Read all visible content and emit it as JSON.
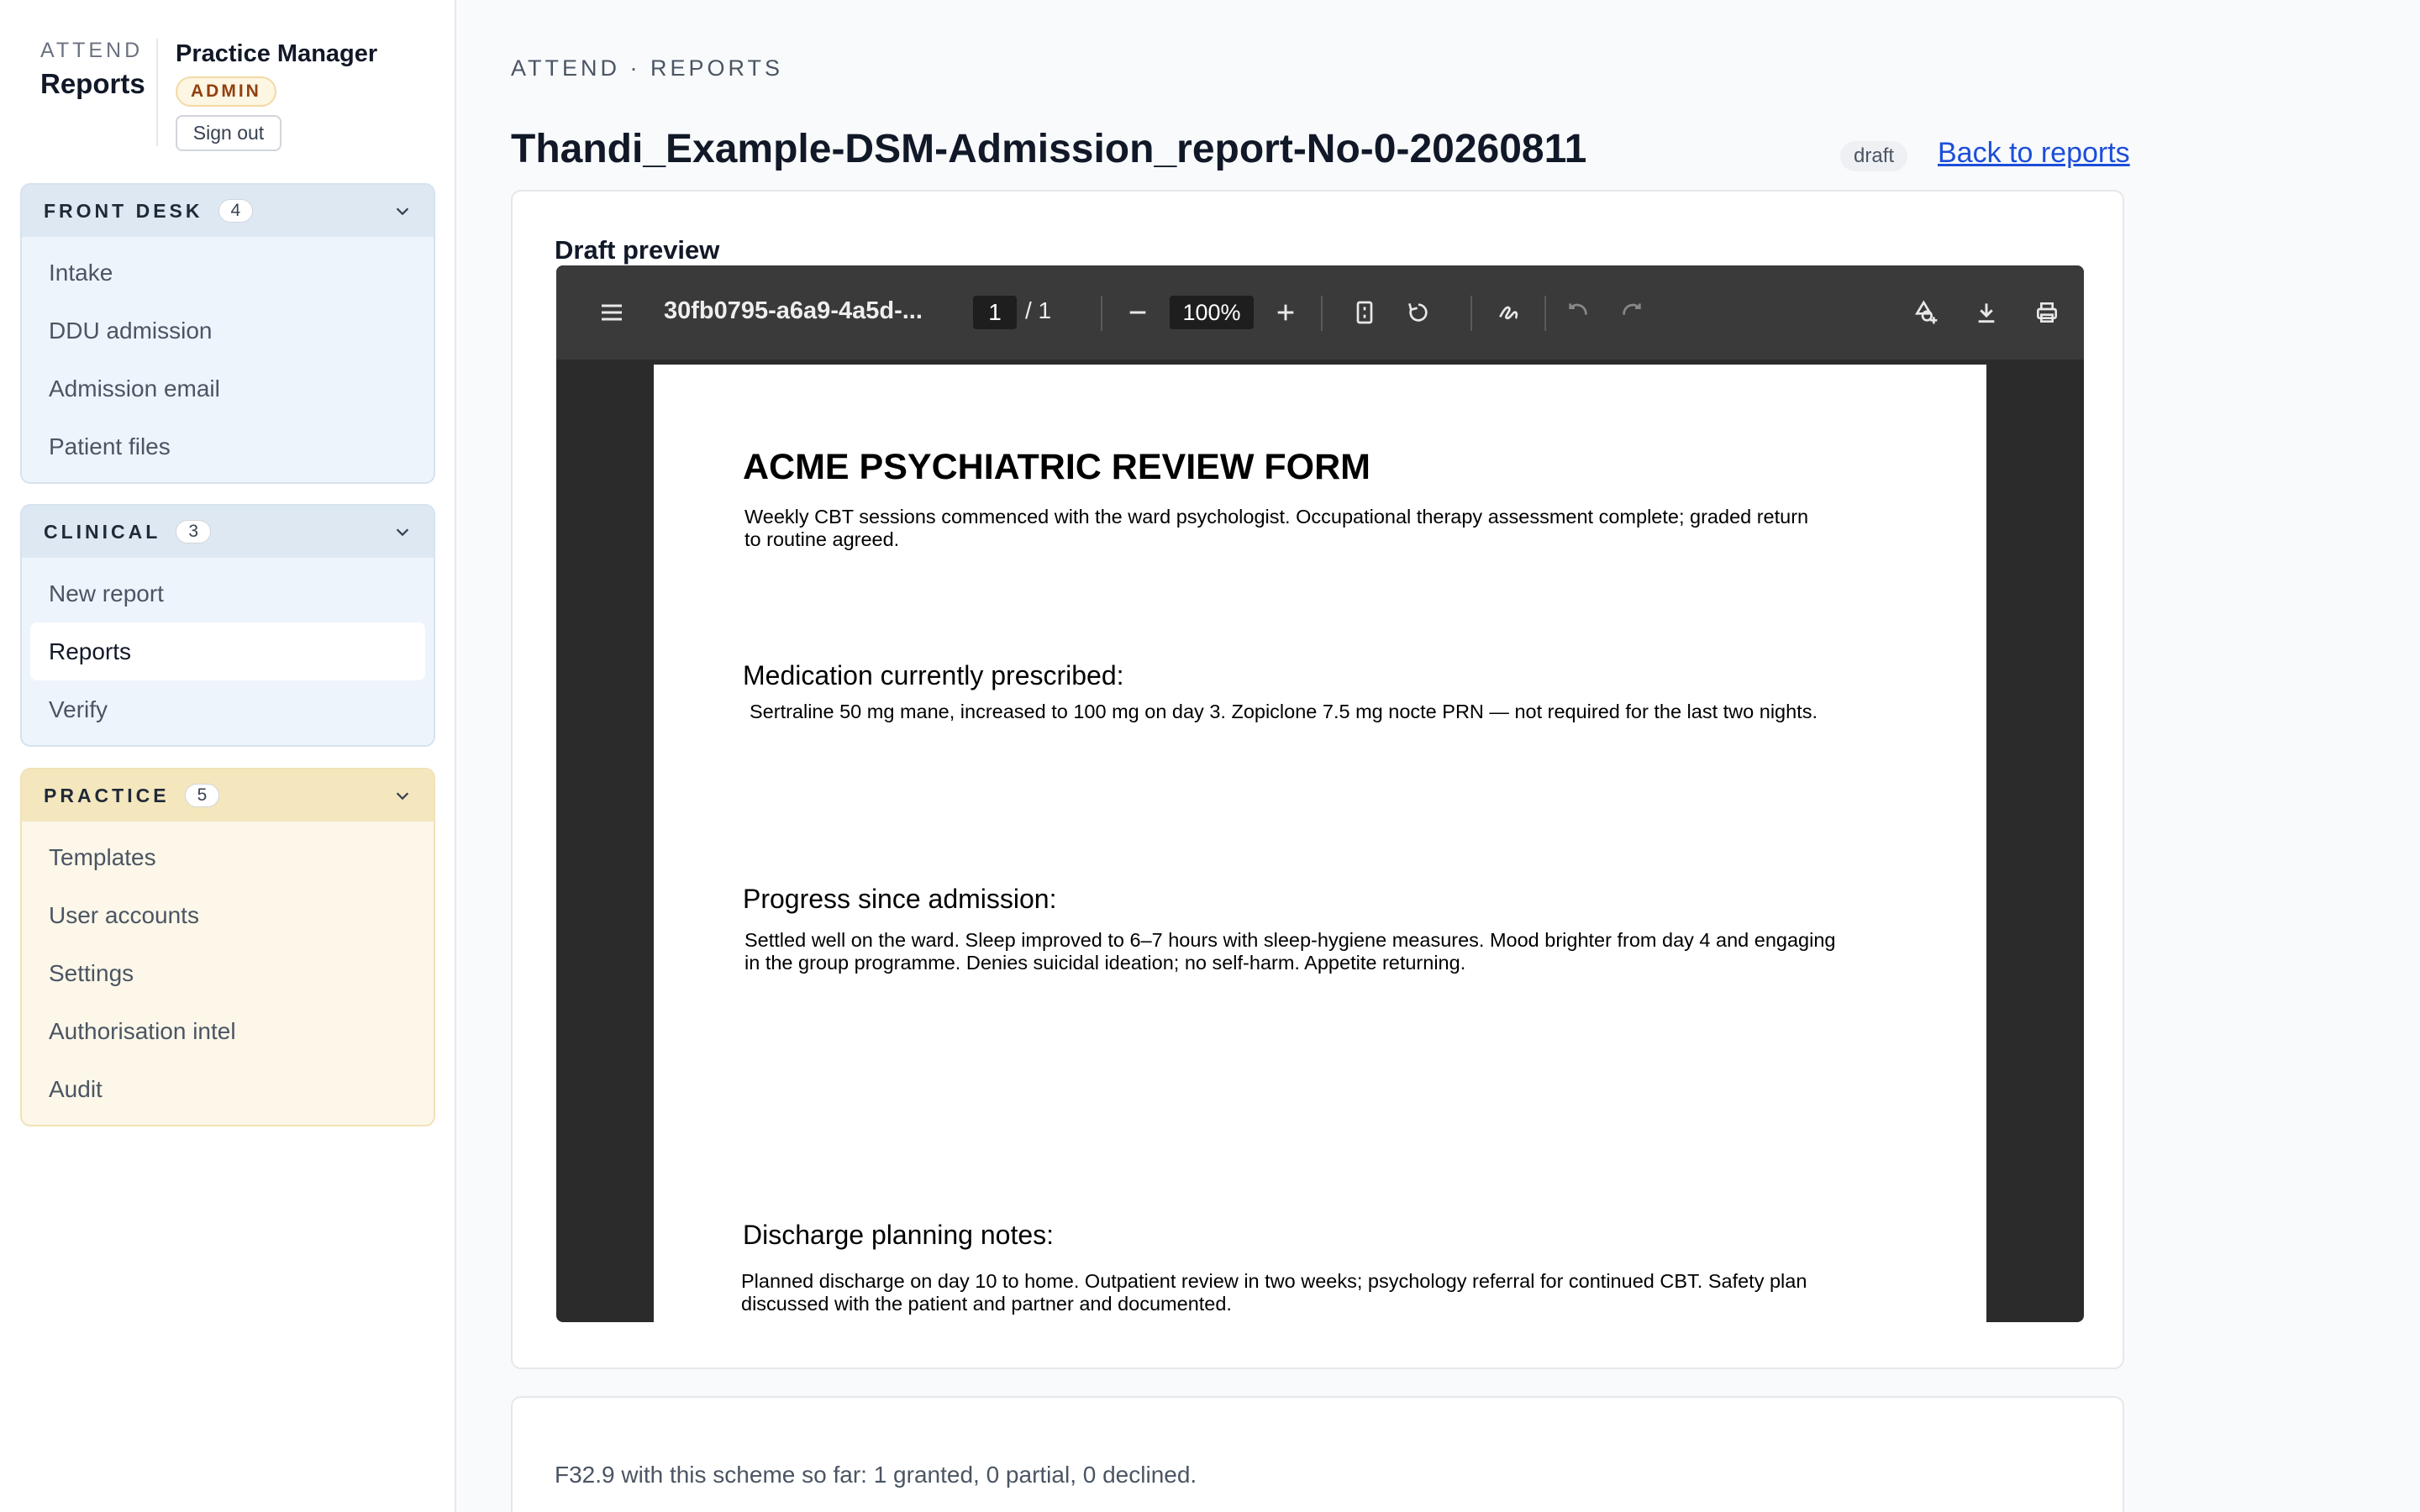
{
  "brand": {
    "small": "ATTEND",
    "big": "Reports"
  },
  "user": {
    "name": "Practice Manager",
    "role": "ADMIN",
    "signout_label": "Sign out"
  },
  "nav": {
    "front_desk": {
      "title": "FRONT DESK",
      "count": "4",
      "items": [
        "Intake",
        "DDU admission",
        "Admission email",
        "Patient files"
      ]
    },
    "clinical": {
      "title": "CLINICAL",
      "count": "3",
      "items": [
        "New report",
        "Reports",
        "Verify"
      ],
      "active": "Reports"
    },
    "practice": {
      "title": "PRACTICE",
      "count": "5",
      "items": [
        "Templates",
        "User accounts",
        "Settings",
        "Authorisation intel",
        "Audit"
      ]
    }
  },
  "header": {
    "breadcrumb": "ATTEND · REPORTS",
    "title": "Thandi_Example-DSM-Admission_report-No-0-20260811",
    "status": "draft",
    "back_link": "Back to reports"
  },
  "preview": {
    "heading": "Draft preview",
    "toolbar": {
      "filename": "30fb0795-a6a9-4a5d-...",
      "page_current": "1",
      "page_total": "/  1",
      "zoom": "100%"
    },
    "document": {
      "title": "ACME PSYCHIATRIC REVIEW FORM",
      "intro_line1": "Weekly CBT sessions commenced with the ward psychologist. Occupational therapy assessment complete; graded return",
      "intro_line2": "to routine agreed.",
      "medication_heading": "Medication currently prescribed:",
      "medication_text": "Sertraline 50 mg mane, increased to 100 mg on day 3. Zopiclone 7.5 mg nocte PRN — not required for the last two nights.",
      "progress_heading": "Progress since admission:",
      "progress_line1": "Settled well on the ward. Sleep improved to 6–7 hours with sleep-hygiene measures. Mood brighter from day 4 and engaging",
      "progress_line2": "in the group programme. Denies suicidal ideation; no self-harm. Appetite returning.",
      "discharge_heading": "Discharge planning notes:",
      "discharge_line1": "Planned discharge on day 10 to home. Outpatient review in two weeks; psychology referral for continued CBT. Safety plan",
      "discharge_line2": "discussed with the patient and partner and documented."
    }
  },
  "scheme_summary": "F32.9 with this scheme so far: 1 granted, 0 partial, 0 declined.",
  "colors": {
    "link": "#1d4ed8",
    "clinical_bg": "#eef4fb",
    "practice_bg": "#fcf7e9",
    "viewer_toolbar": "#3a3a3a"
  }
}
